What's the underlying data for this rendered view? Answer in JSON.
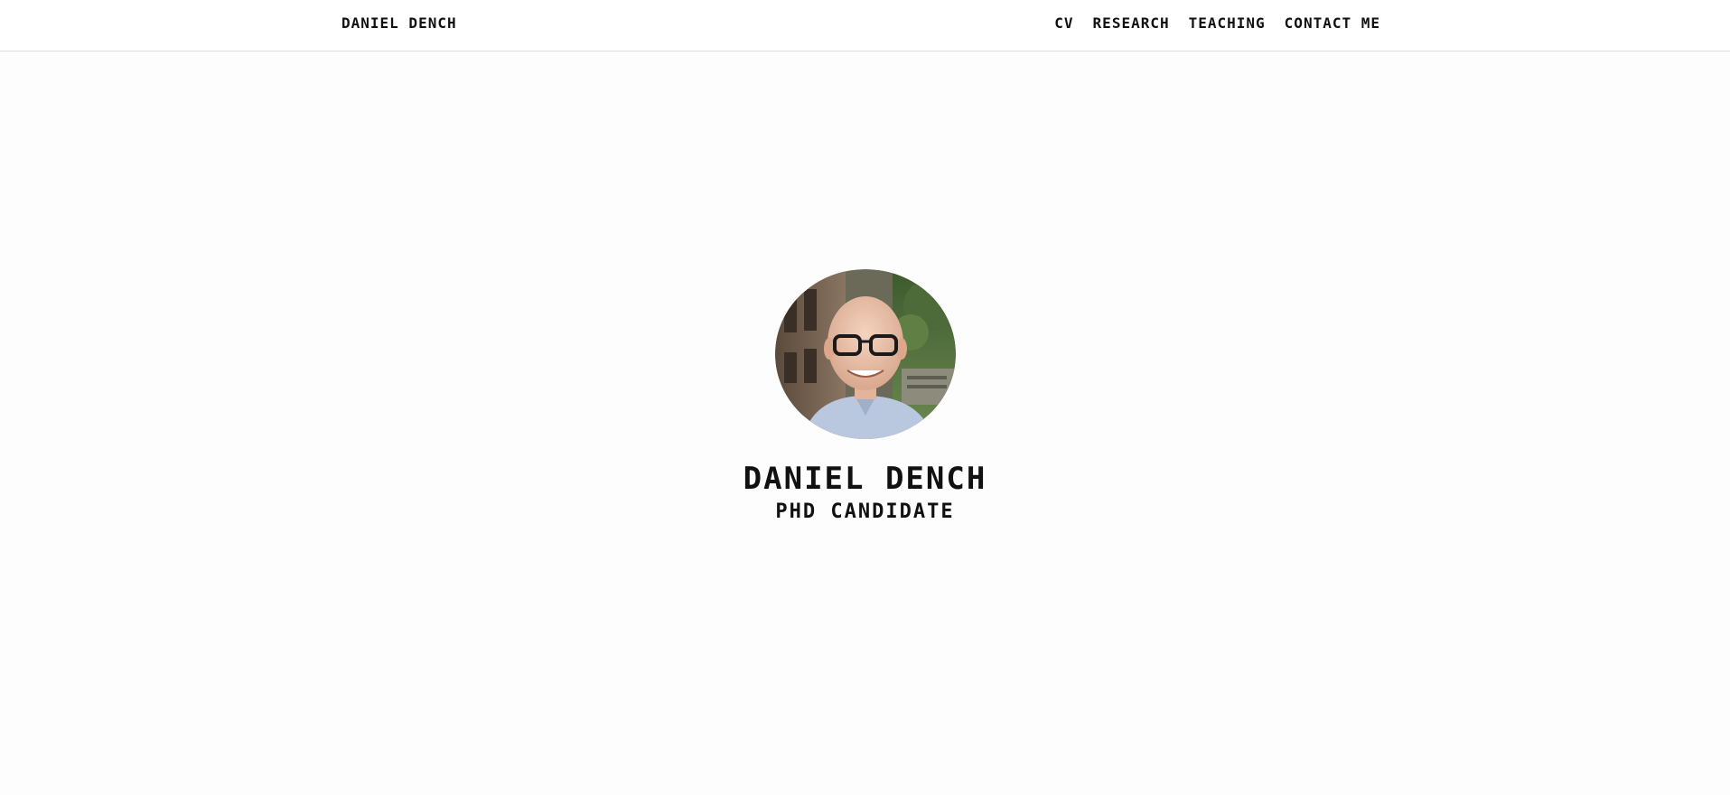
{
  "header": {
    "brand": "DANIEL DENCH",
    "nav": [
      {
        "label": "CV"
      },
      {
        "label": "RESEARCH"
      },
      {
        "label": "TEACHING"
      },
      {
        "label": "CONTACT ME"
      }
    ]
  },
  "hero": {
    "name": "DANIEL DENCH",
    "title": "PHD CANDIDATE"
  }
}
